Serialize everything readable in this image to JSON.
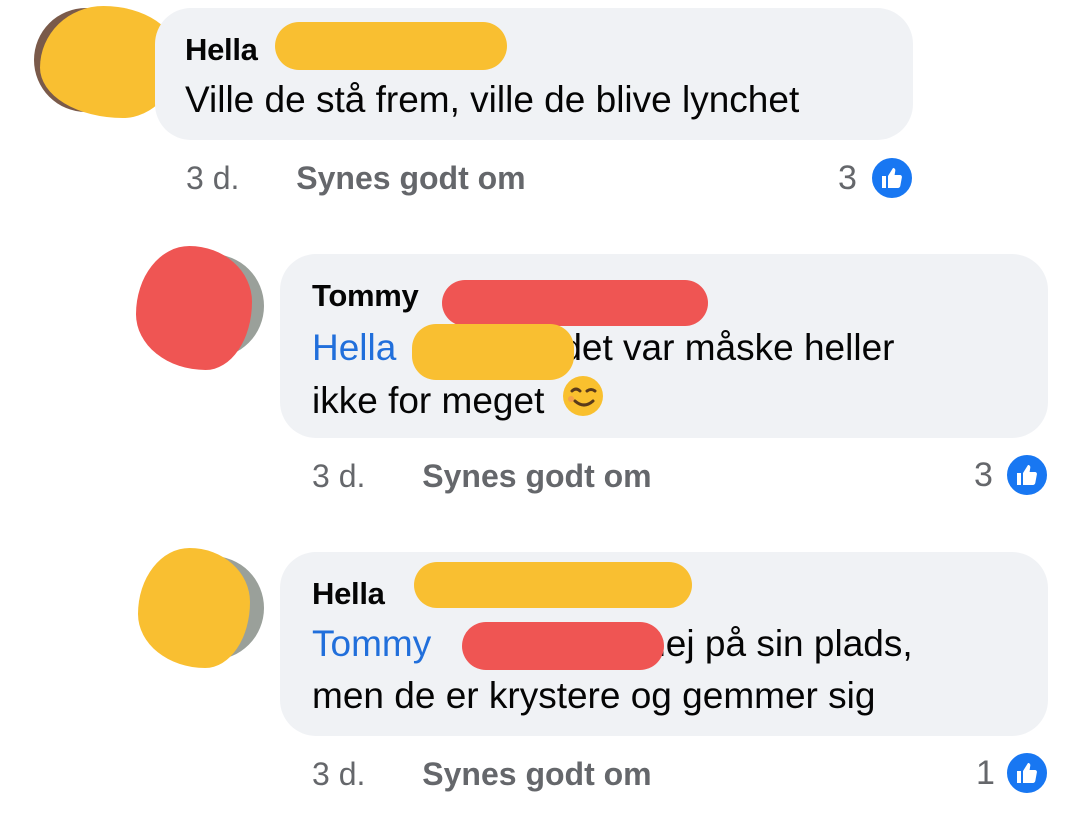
{
  "comments": [
    {
      "author": "Hella",
      "text": "Ville de stå frem, ville de blive lynchet",
      "time": "3 d.",
      "like_label": "Synes godt om",
      "likes": "3"
    },
    {
      "author": "Tommy",
      "mention": "Hella",
      "text_line1": "det var måske heller",
      "text_line2": "ikke for meget",
      "emoji": "wink-emoji",
      "time": "3 d.",
      "like_label": "Synes godt om",
      "likes": "3"
    },
    {
      "author": "Hella",
      "mention": "Tommy",
      "text_line1": "nej på sin plads,",
      "text_line2": "men de er krystere og gemmer sig",
      "time": "3 d.",
      "like_label": "Synes godt om",
      "likes": "1"
    }
  ],
  "colors": {
    "bubble": "#f0f2f5",
    "mention": "#216fdb",
    "like_badge": "#1877f2",
    "redaction_yellow": "#f9bf31",
    "redaction_red": "#ef5553",
    "meta_text": "#65676b"
  },
  "icons": {
    "like": "thumbs-up-icon"
  }
}
